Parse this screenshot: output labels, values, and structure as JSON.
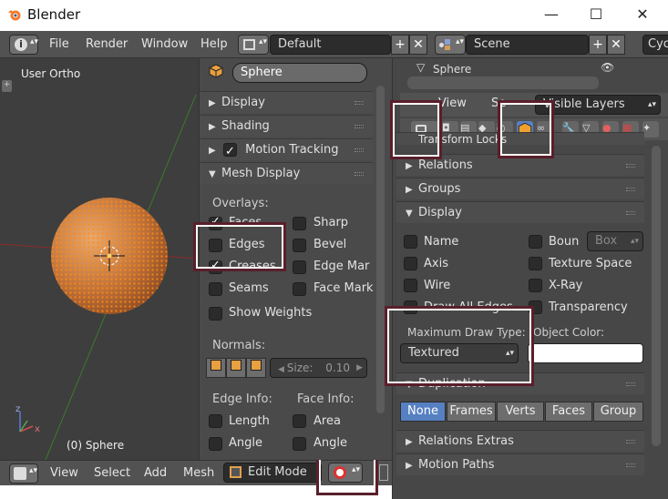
{
  "window": {
    "title": "Blender",
    "minimize": "—",
    "maximize": "☐",
    "close": "✕"
  },
  "header": {
    "menus": [
      "File",
      "Render",
      "Window",
      "Help"
    ],
    "layout": "Default",
    "scene": "Scene",
    "engine": "Cyc"
  },
  "viewport": {
    "view_name": "User Ortho",
    "object_info": "(0) Sphere",
    "axis_x": "x",
    "axis_z": "z"
  },
  "bottombar": {
    "menus": [
      "View",
      "Select",
      "Add",
      "Mesh"
    ],
    "mode": "Edit Mode"
  },
  "mid_panel": {
    "object_name": "Sphere",
    "sections": [
      "Display",
      "Shading",
      "Motion Tracking",
      "Mesh Display"
    ],
    "overlays_label": "Overlays:",
    "overlays": [
      {
        "label": "Faces",
        "checked": true
      },
      {
        "label": "Sharp",
        "checked": false
      },
      {
        "label": "Edges",
        "checked": false
      },
      {
        "label": "Bevel",
        "checked": false
      },
      {
        "label": "Creases",
        "checked": true
      },
      {
        "label": "Edge Mar",
        "checked": false
      },
      {
        "label": "Seams",
        "checked": false
      },
      {
        "label": "Face Mark",
        "checked": false
      }
    ],
    "show_weights": "Show Weights",
    "normals_label": "Normals:",
    "size_label": "Size:",
    "size_value": "0.10",
    "edge_info_label": "Edge Info:",
    "face_info_label": "Face Info:",
    "edge_info": [
      "Length",
      "Angle"
    ],
    "face_info": [
      "Area",
      "Angle"
    ]
  },
  "right_panel": {
    "breadcrumb_object": "Sphere",
    "view_label": "View",
    "search_label": "Se",
    "layers_select": "Visible Layers",
    "partial_section": "Transform Locks",
    "sections_top": [
      "Relations",
      "Groups",
      "Display"
    ],
    "display_items": [
      {
        "label": "Name"
      },
      {
        "label": "Boun"
      },
      {
        "label": "Axis"
      },
      {
        "label": "Texture Space"
      },
      {
        "label": "Wire"
      },
      {
        "label": "X-Ray"
      },
      {
        "label": "Draw All Edges"
      },
      {
        "label": "Transparency"
      }
    ],
    "bounds_type": "Box",
    "max_draw_type_label": "Maximum Draw Type:",
    "max_draw_type_value": "Textured",
    "object_color_label": "Object Color:",
    "duplication_label": "Duplication",
    "dupli_buttons": [
      "None",
      "Frames",
      "Verts",
      "Faces",
      "Group"
    ],
    "sections_bottom": [
      "Relations Extras",
      "Motion Paths"
    ],
    "accent_color": "#5680c2",
    "callout_color": "#5a1f2b"
  }
}
